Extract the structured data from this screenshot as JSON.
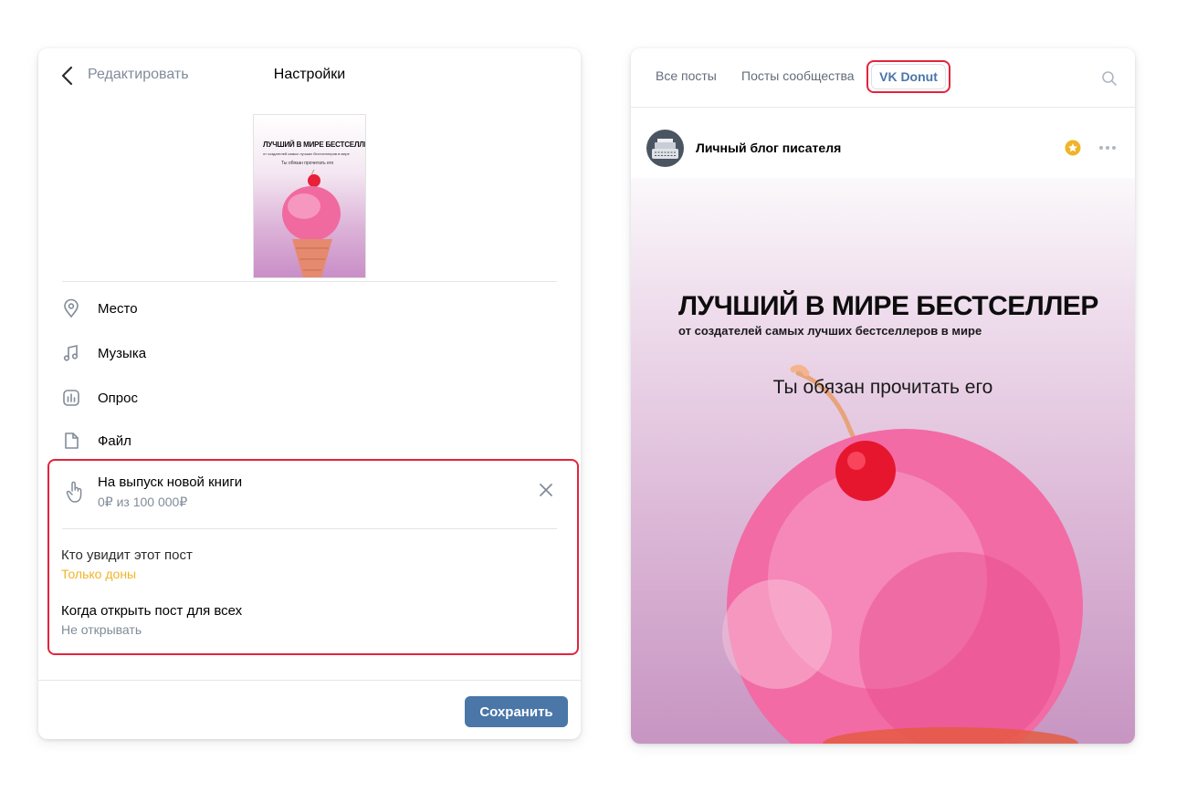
{
  "left_panel": {
    "header": {
      "back_label": "Редактировать",
      "title": "Настройки"
    },
    "thumbnail": {
      "title": "ЛУЧШИЙ В МИРЕ БЕСТСЕЛЛЕР",
      "subtitle": "от создателей самых лучших бестселлеров в мире",
      "cta": "Ты обязан прочитать его"
    },
    "menu": [
      {
        "label": "Место",
        "icon": "location-pin-icon"
      },
      {
        "label": "Музыка",
        "icon": "music-note-icon"
      },
      {
        "label": "Опрос",
        "icon": "poll-icon"
      },
      {
        "label": "Файл",
        "icon": "file-icon"
      }
    ],
    "donut_goal": {
      "title": "На выпуск новой книги",
      "progress": "0₽ из 100 000₽",
      "icon": "hand-pointer-icon"
    },
    "visibility": {
      "label": "Кто увидит этот пост",
      "value": "Только доны"
    },
    "open_time": {
      "label": "Когда открыть пост для всех",
      "value": "Не открывать"
    },
    "save_label": "Сохранить"
  },
  "right_panel": {
    "tabs": [
      {
        "label": "Все посты"
      },
      {
        "label": "Посты сообщества"
      },
      {
        "label": "VK Donut",
        "active": true
      }
    ],
    "post": {
      "author": "Личный блог писателя",
      "image": {
        "title": "ЛУЧШИЙ В МИРЕ БЕСТСЕЛЛЕР",
        "subtitle": "от создателей самых лучших бестселлеров в мире",
        "cta": "Ты обязан прочитать его"
      }
    }
  },
  "colors": {
    "accent": "#4a76a8",
    "highlight_red": "#e3243b",
    "donut_yellow": "#f0b429",
    "secondary_text": "#818c99"
  }
}
